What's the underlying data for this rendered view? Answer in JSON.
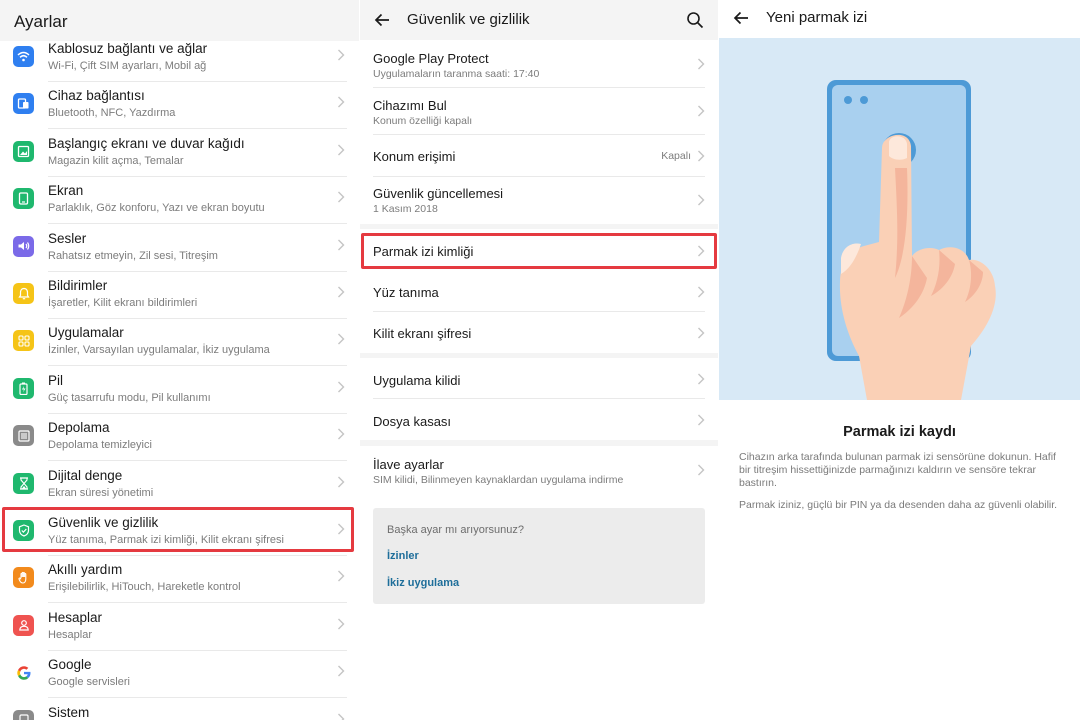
{
  "settings": {
    "title": "Ayarlar",
    "items": [
      {
        "title": "Kablosuz bağlantı ve ağlar",
        "subtitle": "Wi-Fi, Çift SIM ayarları, Mobil ağ",
        "icon": "wifi-icon",
        "color": "#2f7ff0"
      },
      {
        "title": "Cihaz bağlantısı",
        "subtitle": "Bluetooth, NFC, Yazdırma",
        "icon": "device-connection-icon",
        "color": "#2f7ff0"
      },
      {
        "title": "Başlangıç ekranı ve duvar kağıdı",
        "subtitle": "Magazin kilit açma, Temalar",
        "icon": "wallpaper-icon",
        "color": "#1fb86e"
      },
      {
        "title": "Ekran",
        "subtitle": "Parlaklık, Göz konforu, Yazı ve ekran boyutu",
        "icon": "display-icon",
        "color": "#1fb86e"
      },
      {
        "title": "Sesler",
        "subtitle": "Rahatsız etmeyin, Zil sesi, Titreşim",
        "icon": "sound-icon",
        "color": "#7b6ae8"
      },
      {
        "title": "Bildirimler",
        "subtitle": "İşaretler, Kilit ekranı bildirimleri",
        "icon": "bell-icon",
        "color": "#f5c417"
      },
      {
        "title": "Uygulamalar",
        "subtitle": "İzinler, Varsayılan uygulamalar, İkiz uygulama",
        "icon": "apps-icon",
        "color": "#f5c417"
      },
      {
        "title": "Pil",
        "subtitle": "Güç tasarrufu modu, Pil kullanımı",
        "icon": "battery-icon",
        "color": "#1fb86e"
      },
      {
        "title": "Depolama",
        "subtitle": "Depolama temizleyici",
        "icon": "storage-icon",
        "color": "#8a8a8a"
      },
      {
        "title": "Dijital denge",
        "subtitle": "Ekran süresi yönetimi",
        "icon": "hourglass-icon",
        "color": "#1fb86e"
      },
      {
        "title": "Güvenlik ve gizlilik",
        "subtitle": "Yüz tanıma, Parmak izi kimliği, Kilit ekranı şifresi",
        "icon": "shield-icon",
        "color": "#1fb86e"
      },
      {
        "title": "Akıllı yardım",
        "subtitle": "Erişilebilirlik, HiTouch, Hareketle kontrol",
        "icon": "hand-icon",
        "color": "#f28a1c"
      },
      {
        "title": "Hesaplar",
        "subtitle": "Hesaplar",
        "icon": "account-icon",
        "color": "#ef5350"
      },
      {
        "title": "Google",
        "subtitle": "Google servisleri",
        "icon": "google-icon",
        "color": "#ffffff"
      },
      {
        "title": "Sistem",
        "subtitle": "",
        "icon": "system-icon",
        "color": "#8a8a8a"
      }
    ]
  },
  "security": {
    "title": "Güvenlik ve gizlilik",
    "group1": [
      {
        "title": "Google Play Protect",
        "subtitle": "Uygulamaların taranma saati: 17:40",
        "value": ""
      },
      {
        "title": "Cihazımı Bul",
        "subtitle": "Konum özelliği kapalı",
        "value": ""
      },
      {
        "title": "Konum erişimi",
        "subtitle": "",
        "value": "Kapalı"
      },
      {
        "title": "Güvenlik güncellemesi",
        "subtitle": "1 Kasım 2018",
        "value": ""
      }
    ],
    "group2": [
      {
        "title": "Parmak izi kimliği"
      },
      {
        "title": "Yüz tanıma"
      },
      {
        "title": "Kilit ekranı şifresi"
      }
    ],
    "group3": [
      {
        "title": "Uygulama kilidi"
      },
      {
        "title": "Dosya kasası"
      }
    ],
    "group4": [
      {
        "title": "İlave ayarlar",
        "subtitle": "SIM kilidi, Bilinmeyen kaynaklardan uygulama indirme"
      }
    ],
    "suggestion": {
      "question": "Başka ayar mı arıyorsunuz?",
      "links": [
        "İzinler",
        "İkiz uygulama"
      ]
    }
  },
  "fingerprint": {
    "title": "Yeni parmak izi",
    "heading": "Parmak izi kaydı",
    "desc1": "Cihazın arka tarafında bulunan parmak izi sensörüne dokunun. Hafif bir titreşim hissettiğinizde parmağınızı kaldırın ve sensöre tekrar bastırın.",
    "desc2": "Parmak iziniz, güçlü bir PIN ya da desenden daha az güvenli olabilir."
  },
  "colors": {
    "highlight": "#e53a40",
    "link": "#1e6e9a",
    "illustration_bg": "#d8e9f6"
  }
}
